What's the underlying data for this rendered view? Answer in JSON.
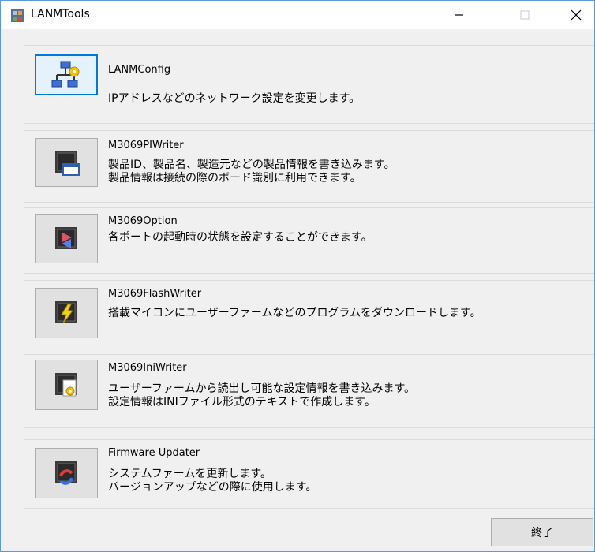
{
  "window": {
    "title": "LANMTools",
    "minimize_symbol": "—",
    "maximize_symbol": "☐",
    "close_symbol": "✕"
  },
  "tools": [
    {
      "name": "LANMConfig",
      "description": [
        "IPアドレスなどのネットワーク設定を変更します。"
      ],
      "icon": "network-config-icon",
      "focused": true
    },
    {
      "name": "M3069PIWriter",
      "description": [
        "製品ID、製品名、製造元などの製品情報を書き込みます。",
        "製品情報は接続の際のボード識別に利用できます。"
      ],
      "icon": "chip-card-icon"
    },
    {
      "name": "M3069Option",
      "description": [
        "各ポートの起動時の状態を設定することができます。"
      ],
      "icon": "chip-ports-icon"
    },
    {
      "name": "M3069FlashWriter",
      "description": [
        "搭載マイコンにユーザーファームなどのプログラムをダウンロードします。"
      ],
      "icon": "chip-flash-icon"
    },
    {
      "name": "M3069IniWriter",
      "description": [
        "ユーザーファームから読出し可能な設定情報を書き込みます。",
        "設定情報はINIファイル形式のテキストで作成します。"
      ],
      "icon": "chip-settings-icon"
    },
    {
      "name": "Firmware Updater",
      "description": [
        "システムファームを更新します。",
        "バージョンアップなどの際に使用します。"
      ],
      "icon": "chip-update-icon"
    }
  ],
  "footer": {
    "exit_label": "終了"
  },
  "colors": {
    "accent": "#0078d7",
    "window_border": "#5b9bd5",
    "background": "#f0f0f0"
  }
}
